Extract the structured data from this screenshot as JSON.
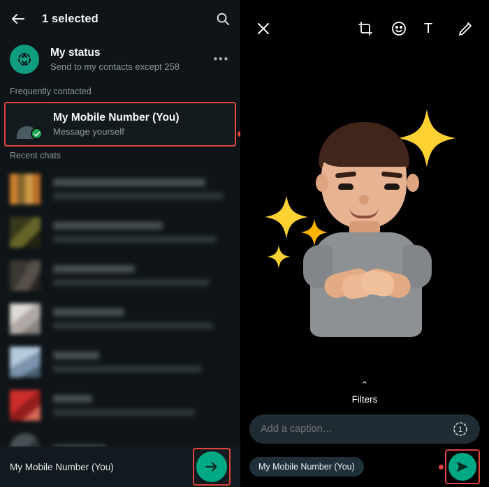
{
  "share_sheet": {
    "header": {
      "back_icon": "back-arrow-icon",
      "title": "1 selected",
      "search_icon": "search-icon"
    },
    "status": {
      "icon": "status-rings-icon",
      "title": "My status",
      "subtitle": "Send to my contacts except 258",
      "overflow": "•••"
    },
    "sections": {
      "frequently_contacted": "Frequently contacted",
      "recent_chats": "Recent chats"
    },
    "selected_contact": {
      "name": "My Mobile Number (You)",
      "subtitle": "Message yourself",
      "selected": true,
      "check_icon": "check-icon"
    },
    "recent_chats_count": 7,
    "bottom": {
      "recipients_label": "My Mobile Number (You)",
      "send_fab_icon": "arrow-right-icon",
      "highlight_color": "#e0443e",
      "fab_color": "#00a884"
    }
  },
  "media_editor": {
    "header": {
      "close_icon": "close-icon",
      "tools": [
        {
          "name": "crop-rotate-icon",
          "label": ""
        },
        {
          "name": "sticker-emoji-icon",
          "label": ""
        },
        {
          "name": "text-tool-icon",
          "label": "T"
        },
        {
          "name": "draw-pen-icon",
          "label": ""
        }
      ]
    },
    "media": {
      "description": "3D avatar sticker with sparkles",
      "background": "#000000"
    },
    "filters": {
      "chevron": "⌃",
      "label": "Filters"
    },
    "caption": {
      "value": "",
      "placeholder": "Add a caption…",
      "view_once_icon": "view-once-icon",
      "view_once_badge": "1"
    },
    "bottom": {
      "recipient_chip": "My Mobile Number (You)",
      "send_icon": "send-icon",
      "highlight_color": "#e0443e",
      "send_color": "#00a884"
    }
  }
}
